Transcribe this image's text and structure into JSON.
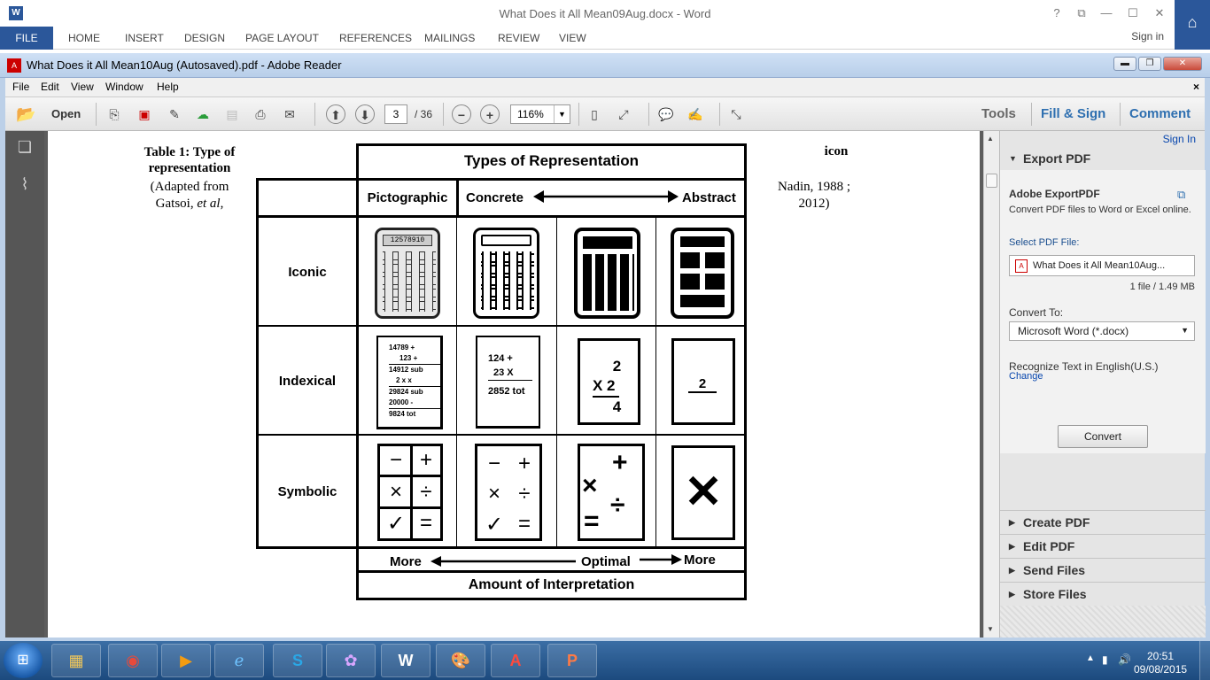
{
  "word": {
    "title": "What Does it All Mean09Aug.docx - Word",
    "logo": "W",
    "controls": [
      "?",
      "⧉",
      "—",
      "☐",
      "✕"
    ],
    "file_tab": "FILE",
    "tabs": [
      "HOME",
      "INSERT",
      "DESIGN",
      "PAGE LAYOUT",
      "REFERENCES",
      "MAILINGS",
      "REVIEW",
      "VIEW"
    ],
    "sign_in": "Sign in"
  },
  "reader": {
    "title": "What Does it All Mean10Aug (Autosaved).pdf - Adobe Reader",
    "menu": [
      "File",
      "Edit",
      "View",
      "Window",
      "Help"
    ],
    "menu_close": "×",
    "open_label": "Open",
    "page_current": "3",
    "page_total": "/ 36",
    "zoom": "116%",
    "tools": "Tools",
    "fill_sign": "Fill & Sign",
    "comment": "Comment"
  },
  "panel": {
    "sign_in": "Sign In",
    "export_pdf_header": "Export PDF",
    "adobe_exportpdf": "Adobe ExportPDF",
    "description": "Convert PDF files to Word or Excel online.",
    "select_file_label": "Select PDF File:",
    "selected_file": "What Does it All Mean10Aug...",
    "file_info": "1 file / 1.49 MB",
    "convert_to_label": "Convert To:",
    "convert_to_value": "Microsoft Word (*.docx)",
    "recognize_text": "Recognize Text in English(U.S.)",
    "change_link": "Change",
    "convert_button": "Convert",
    "sections": [
      "Create PDF",
      "Edit PDF",
      "Send Files",
      "Store Files"
    ]
  },
  "document": {
    "caption_line1": "Table 1: Type of",
    "caption_line2": "representation",
    "adapted_line1": "(Adapted from",
    "adapted_line2_a": "Gatsoi, ",
    "adapted_line2_b": "et al",
    "adapted_line2_c": ",",
    "right_icon": "icon",
    "right_cite1": "Nadin, 1988 ;",
    "right_cite2": "2012)",
    "table_title": "Types of Representation",
    "col_pictographic": "Pictographic",
    "col_concrete": "Concrete",
    "col_abstract": "Abstract",
    "row_iconic": "Iconic",
    "row_indexical": "Indexical",
    "row_symbolic": "Symbolic",
    "footer_more_left": "More",
    "footer_optimal": "Optimal",
    "footer_more_right": "More",
    "footer_interpretation": "Amount of Interpretation",
    "calc_display": "12578910",
    "receipt1": [
      "14789 +",
      "123 +",
      "14912 sub",
      "2 x x",
      "29824 sub",
      "20000 -",
      "9824 tot"
    ],
    "receipt2": [
      "124 +",
      "23 X",
      "2852 tot"
    ],
    "card_mult": [
      "2",
      "X  2",
      "4"
    ],
    "card_two": "2",
    "sym_grid": [
      "−",
      "+",
      "×",
      "÷",
      "✓",
      "="
    ],
    "sym_mix": [
      "×",
      "+",
      "÷",
      "="
    ],
    "sym_x": "✕"
  },
  "taskbar": {
    "time": "20:51",
    "date": "09/08/2015",
    "apps": [
      "file-explorer",
      "chrome",
      "media-player",
      "internet-explorer",
      "skype",
      "app",
      "word",
      "paint",
      "adobe-reader",
      "powerpoint"
    ]
  }
}
